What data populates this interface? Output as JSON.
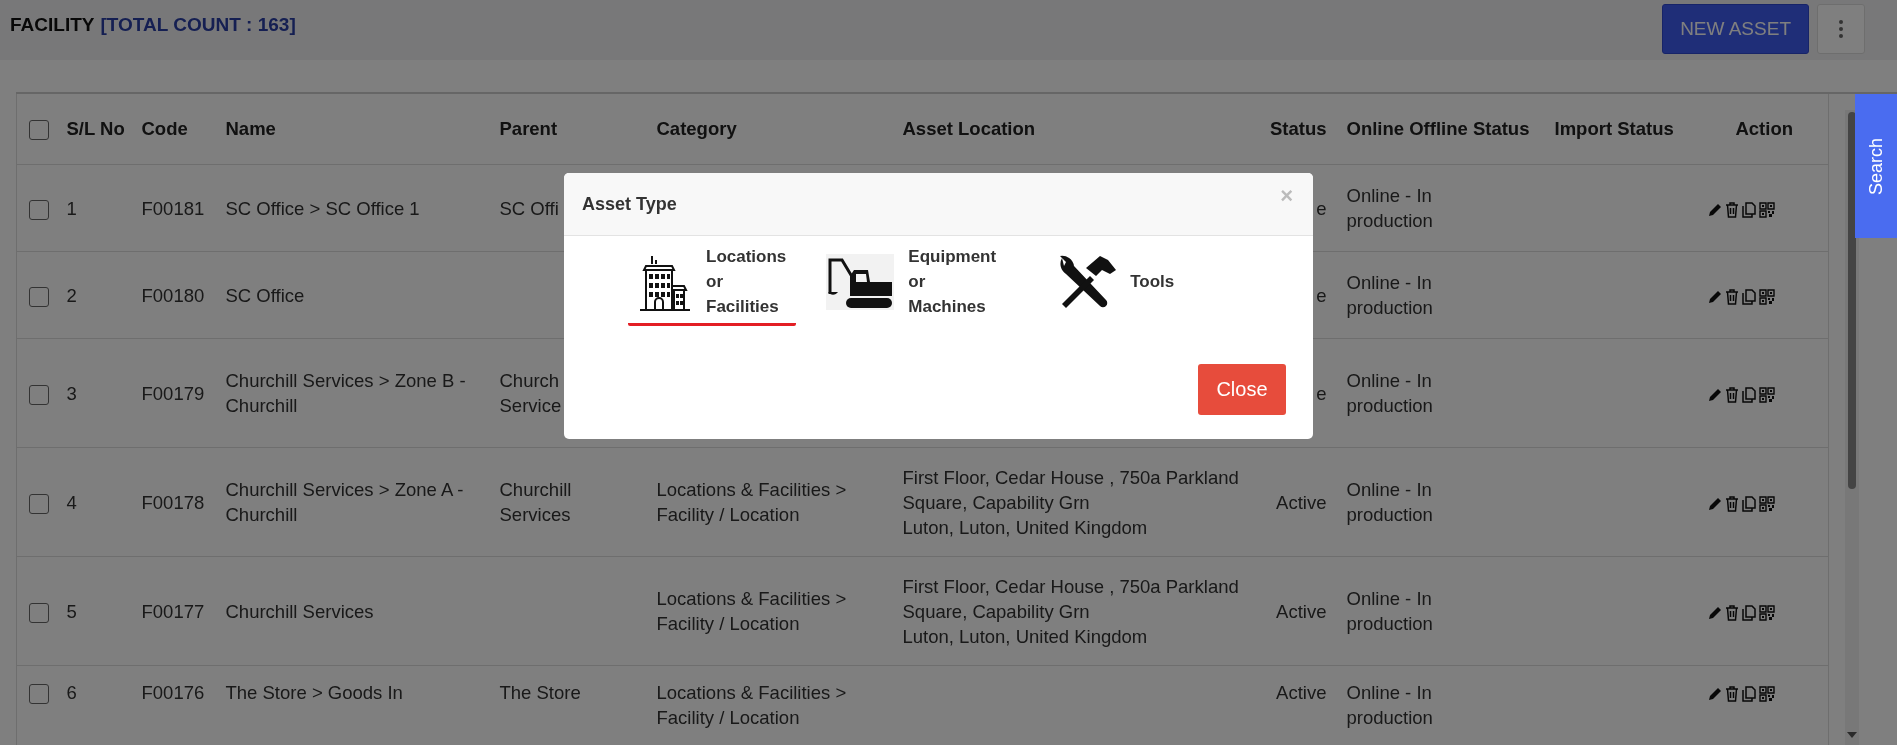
{
  "header": {
    "title": "FACILITY",
    "total_count": "[TOTAL COUNT : 163]",
    "new_button": "NEW ASSET"
  },
  "table": {
    "select_all": {
      "checked": false
    },
    "columns": [
      "S/L No",
      "Code",
      "Name",
      "Parent",
      "Category",
      "Asset Location",
      "Status",
      "Online Offline Status",
      "Import Status",
      "Action"
    ],
    "rows": [
      {
        "checked": false,
        "sl": "1",
        "code": "F00181",
        "name": "SC Office > SC Office 1",
        "parent": "SC Offi",
        "status": "e",
        "online": "Online - In production"
      },
      {
        "checked": false,
        "sl": "2",
        "code": "F00180",
        "name": "SC Office",
        "status": "e",
        "online": "Online - In production"
      },
      {
        "checked": false,
        "sl": "3",
        "code": "F00179",
        "name": "Churchill Services > Zone B - Churchill",
        "parent": "Church\nService",
        "status": "e",
        "online": "Online - In production"
      },
      {
        "checked": false,
        "sl": "4",
        "code": "F00178",
        "name": "Churchill Services > Zone A - Churchill",
        "parent": "Churchill Services",
        "category": "Locations & Facilities > Facility / Location",
        "location": "First Floor, Cedar House , 750a Parkland Square, Capability Grn\nLuton, Luton, United Kingdom",
        "status": "Active",
        "online": "Online - In production"
      },
      {
        "checked": false,
        "sl": "5",
        "code": "F00177",
        "name": "Churchill Services",
        "category": "Locations & Facilities > Facility / Location",
        "location": "First Floor, Cedar House , 750a Parkland Square, Capability Grn\nLuton, Luton, United Kingdom",
        "status": "Active",
        "online": "Online - In production"
      },
      {
        "checked": false,
        "sl": "6",
        "code": "F00176",
        "name": "The Store > Goods In",
        "parent": "The Store",
        "category": "Locations & Facilities > Facility / Location",
        "status": "Active",
        "online": "Online - In production"
      }
    ]
  },
  "side_tab": "Search",
  "modal": {
    "title": "Asset Type",
    "close_icon": "×",
    "options": [
      {
        "kind": "building",
        "label": "Locations\nor\nFacilities",
        "selected": true
      },
      {
        "kind": "excavator",
        "label": "Equipment\nor\nMachines",
        "selected": false
      },
      {
        "kind": "tools",
        "label": "Tools",
        "selected": false
      }
    ],
    "close_button": "Close"
  }
}
